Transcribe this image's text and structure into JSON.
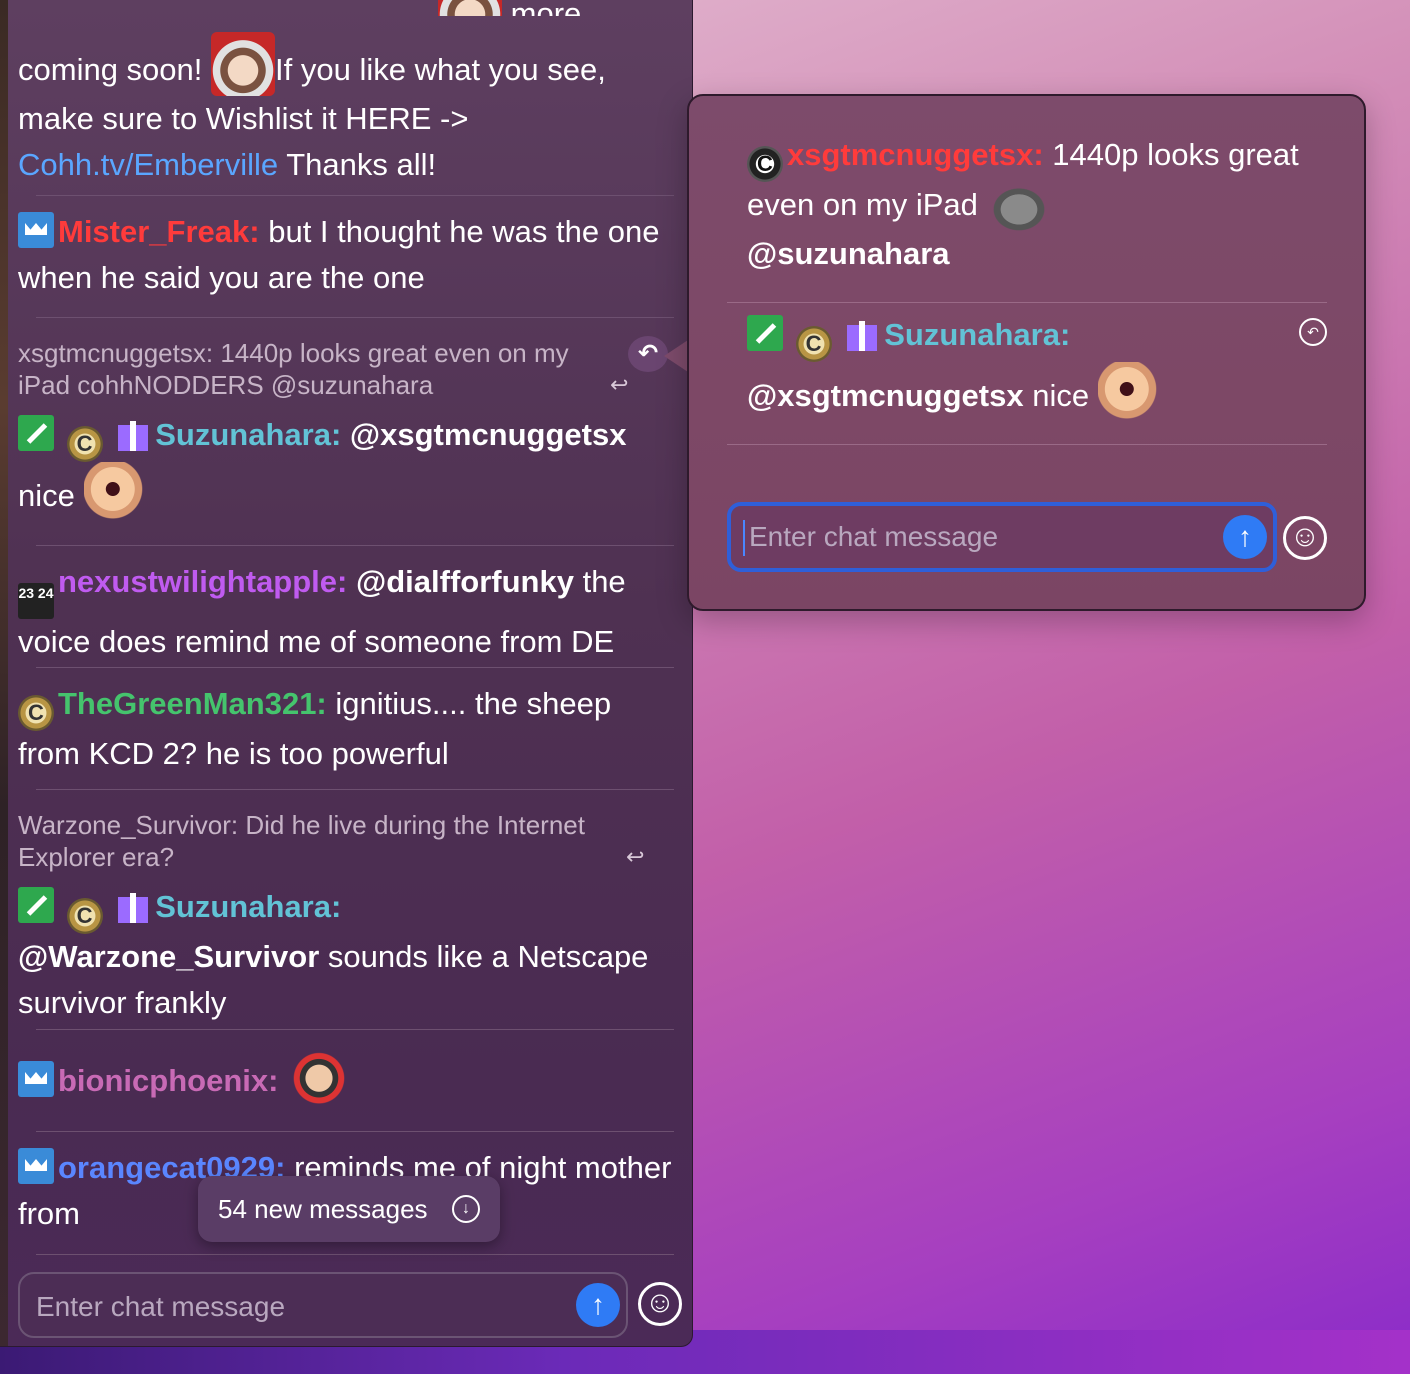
{
  "chat": {
    "top_partial": "more",
    "messages": [
      {
        "parts": {
          "a": "coming soon!",
          "b": "If you like what you see, make sure to Wishlist it HERE ->",
          "link": "Cohh.tv/Emberville",
          "c": "Thanks all!"
        }
      },
      {
        "user": "Mister_Freak:",
        "text": "but I thought he was the one when he said you are the one"
      },
      {
        "reply_context": "xsgtmcnuggetsx: 1440p looks great even on my iPad cohhNODDERS @suzunahara",
        "user": "Suzunahara:",
        "mention": "@xsgtmcnuggetsx",
        "text": "nice"
      },
      {
        "user": "nexustwilightapple:",
        "mention": "@dialfforfunky",
        "text": "the voice does remind me of someone from DE",
        "badge": "23 24"
      },
      {
        "user": "TheGreenMan321:",
        "text": "ignitius.... the sheep from KCD 2? he is too powerful"
      },
      {
        "reply_context": "Warzone_Survivor: Did he live during the Internet Explorer era?",
        "user": "Suzunahara:",
        "mention": "@Warzone_Survivor",
        "text": "sounds like a Netscape survivor frankly"
      },
      {
        "user": "bionicphoenix:"
      },
      {
        "user": "orangecat0929:",
        "text": "reminds me of night mother from"
      }
    ],
    "new_messages": "54 new messages",
    "input_placeholder": "Enter chat message",
    "colors": {
      "red": "#ff3b3b",
      "teal": "#62c3d6",
      "purple": "#c05bf0",
      "green": "#45c46d",
      "pink": "#c86ab5",
      "blue": "#5a86ff"
    }
  },
  "popup": {
    "msg1": {
      "user": "xsgtmcnuggetsx:",
      "text": "1440p looks great even on my iPad",
      "mention": "@suzunahara"
    },
    "msg2": {
      "user": "Suzunahara:",
      "mention": "@xsgtmcnuggetsx",
      "text": "nice"
    },
    "input_placeholder": "Enter chat message"
  },
  "icons": {
    "reply": "reply-arrow-icon",
    "send": "send-arrow-up-icon",
    "emoji": "smiley-icon",
    "download": "arrow-down-circle-icon",
    "badge_coin": "C"
  }
}
